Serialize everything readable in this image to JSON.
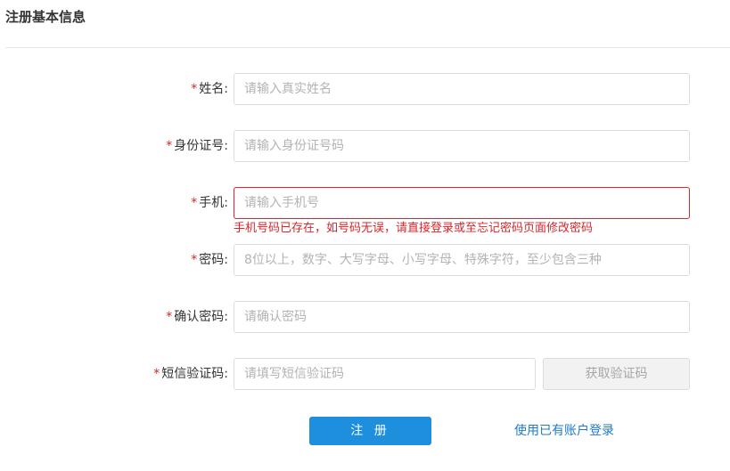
{
  "header": {
    "title": "注册基本信息"
  },
  "form": {
    "required_mark": "*",
    "name": {
      "label": "姓名:",
      "placeholder": "请输入真实姓名",
      "value": ""
    },
    "id_card": {
      "label": "身份证号:",
      "placeholder": "请输入身份证号码",
      "value": ""
    },
    "phone": {
      "label": "手机:",
      "placeholder": "请输入手机号",
      "value": "",
      "error": "手机号码已存在，如号码无误，请直接登录或至忘记密码页面修改密码"
    },
    "password": {
      "label": "密码:",
      "placeholder": "8位以上，数字、大写字母、小写字母、特殊字符，至少包含三种",
      "value": ""
    },
    "confirm_password": {
      "label": "确认密码:",
      "placeholder": "请确认密码",
      "value": ""
    },
    "sms_code": {
      "label": "短信验证码:",
      "placeholder": "请填写短信验证码",
      "value": "",
      "button_label": "获取验证码"
    }
  },
  "actions": {
    "submit_label": "注 册",
    "login_link_label": "使用已有账户登录"
  },
  "colors": {
    "primary": "#1d8fdc",
    "error": "#d9252b",
    "link": "#1f7bc9"
  }
}
